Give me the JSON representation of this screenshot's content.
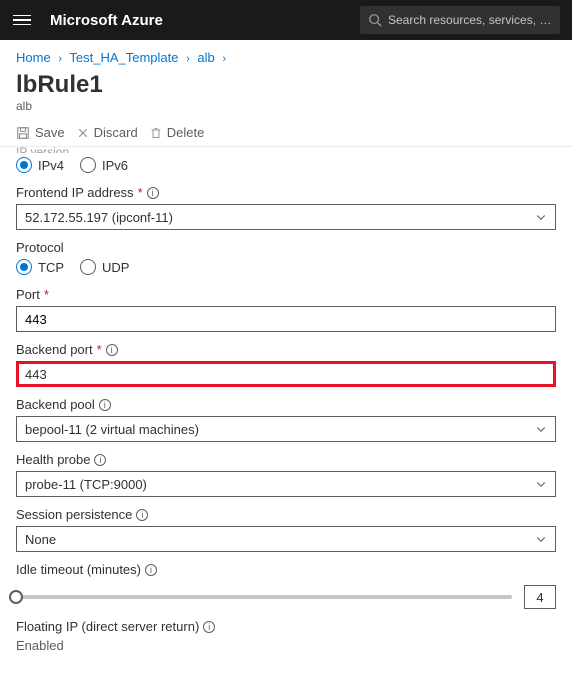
{
  "topbar": {
    "brand": "Microsoft Azure",
    "search_placeholder": "Search resources, services, and docs (G+/)"
  },
  "breadcrumb": {
    "items": [
      "Home",
      "Test_HA_Template",
      "alb"
    ]
  },
  "page": {
    "title": "lbRule1",
    "subtitle": "alb"
  },
  "commands": {
    "save": "Save",
    "discard": "Discard",
    "delete": "Delete"
  },
  "ip_version": {
    "label_partial": "IP version",
    "ipv4": "IPv4",
    "ipv6": "IPv6",
    "selected": "ipv4"
  },
  "frontend_ip": {
    "label": "Frontend IP address",
    "value": "52.172.55.197 (ipconf-11)"
  },
  "protocol": {
    "label": "Protocol",
    "tcp": "TCP",
    "udp": "UDP",
    "selected": "tcp"
  },
  "port": {
    "label": "Port",
    "value": "443"
  },
  "backend_port": {
    "label": "Backend port",
    "value": "443"
  },
  "backend_pool": {
    "label": "Backend pool",
    "value": "bepool-11 (2 virtual machines)"
  },
  "health_probe": {
    "label": "Health probe",
    "value": "probe-11 (TCP:9000)"
  },
  "session_persistence": {
    "label": "Session persistence",
    "value": "None"
  },
  "idle_timeout": {
    "label": "Idle timeout (minutes)",
    "value": "4"
  },
  "floating_ip": {
    "label": "Floating IP (direct server return)",
    "value": "Enabled"
  }
}
